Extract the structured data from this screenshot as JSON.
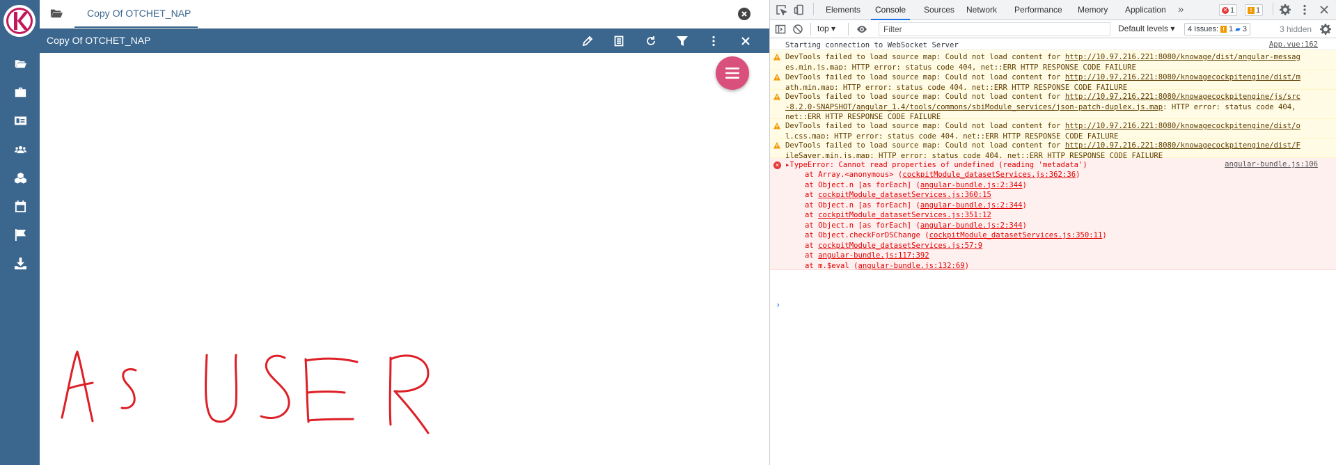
{
  "colors": {
    "brand": "#3b678f",
    "fab": "#d9507c",
    "handwriting": "#dd1f26"
  },
  "sidebar": {
    "logo_letter": "K",
    "items": [
      {
        "icon": "folder-open-icon"
      },
      {
        "icon": "briefcase-icon"
      },
      {
        "icon": "id-card-icon"
      },
      {
        "icon": "users-icon"
      },
      {
        "icon": "cubes-icon"
      },
      {
        "icon": "calendar-icon"
      },
      {
        "icon": "flag-icon"
      },
      {
        "icon": "download-icon"
      }
    ]
  },
  "document": {
    "tab_label": "Copy Of OTCHET_NAP",
    "toolbar_title": "Copy Of OTCHET_NAP",
    "handwriting_text": "As USER"
  },
  "devtools": {
    "tabs": [
      "Elements",
      "Console",
      "Sources",
      "Network",
      "Performance",
      "Memory",
      "Application"
    ],
    "active_tab": "Console",
    "more": "»",
    "error_count": "1",
    "warning_count": "1",
    "context": "top",
    "filter_placeholder": "Filter",
    "levels": "Default levels",
    "issues_label": "4 Issues:",
    "issues_warn": "1",
    "issues_info": "3",
    "hidden": "3 hidden",
    "messages": [
      {
        "type": "log",
        "text": "Starting connection to WebSocket Server",
        "source": "App.vue:162"
      },
      {
        "type": "warn",
        "prefix": "DevTools failed to load source map: Could not load content for ",
        "url": "http://10.97.216.221:8080/knowage/dist/angular-messages.min.js.map",
        "suffix": ": HTTP error: status code 404, net::ERR_HTTP_RESPONSE_CODE_FAILURE"
      },
      {
        "type": "warn",
        "prefix": "DevTools failed to load source map: Could not load content for ",
        "url": "http://10.97.216.221:8080/knowagecockpitengine/dist/math.min.map",
        "suffix": ": HTTP error: status code 404, net::ERR_HTTP_RESPONSE_CODE_FAILURE"
      },
      {
        "type": "warn",
        "prefix": "DevTools failed to load source map: Could not load content for ",
        "url": "http://10.97.216.221:8080/knowagecockpitengine/js/src-8.2.0-SNAPSHOT/angular_1.4/tools/commons/sbiModule_services/json-patch-duplex.js.map",
        "suffix": ": HTTP error: status code 404, net::ERR_HTTP_RESPONSE_CODE_FAILURE"
      },
      {
        "type": "warn",
        "prefix": "DevTools failed to load source map: Could not load content for ",
        "url": "http://10.97.216.221:8080/knowagecockpitengine/dist/ol.css.map",
        "suffix": ": HTTP error: status code 404, net::ERR_HTTP_RESPONSE_CODE_FAILURE"
      },
      {
        "type": "warn",
        "prefix": "DevTools failed to load source map: Could not load content for ",
        "url": "http://10.97.216.221:8080/knowagecockpitengine/dist/FileSaver.min.js.map",
        "suffix": ": HTTP error: status code 404, net::ERR_HTTP_RESPONSE_CODE_FAILURE"
      }
    ],
    "error": {
      "message": "TypeError: Cannot read properties of undefined (reading 'metadata')",
      "source": "angular-bundle.js:106",
      "stack": [
        {
          "fn": "at Array.<anonymous> (",
          "loc": "cockpitModule_datasetServices.js:362:36",
          "end": ")"
        },
        {
          "fn": "at Object.n [as forEach] (",
          "loc": "angular-bundle.js:2:344",
          "end": ")"
        },
        {
          "fn": "at ",
          "loc": "cockpitModule_datasetServices.js:360:15",
          "end": ""
        },
        {
          "fn": "at Object.n [as forEach] (",
          "loc": "angular-bundle.js:2:344",
          "end": ")"
        },
        {
          "fn": "at ",
          "loc": "cockpitModule_datasetServices.js:351:12",
          "end": ""
        },
        {
          "fn": "at Object.n [as forEach] (",
          "loc": "angular-bundle.js:2:344",
          "end": ")"
        },
        {
          "fn": "at Object.checkForDSChange (",
          "loc": "cockpitModule_datasetServices.js:350:11",
          "end": ")"
        },
        {
          "fn": "at ",
          "loc": "cockpitModule_datasetServices.js:57:9",
          "end": ""
        },
        {
          "fn": "at ",
          "loc": "angular-bundle.js:117:392",
          "end": ""
        },
        {
          "fn": "at m.$eval (",
          "loc": "angular-bundle.js:132:69",
          "end": ")"
        }
      ]
    },
    "prompt": "›"
  }
}
